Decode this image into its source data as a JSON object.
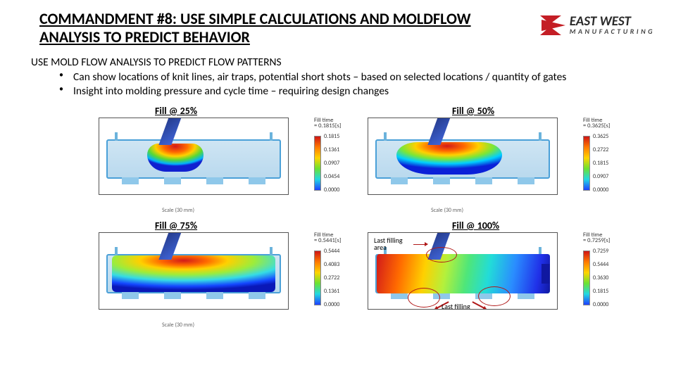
{
  "header": {
    "title": "COMMANDMENT #8: USE SIMPLE CALCULATIONS AND MOLDFLOW ANALYSIS TO PREDICT BEHAVIOR",
    "logo_main": "EAST WEST",
    "logo_sub": "MANUFACTURING"
  },
  "subtitle": "USE MOLD FLOW ANALYSIS TO PREDICT FLOW PATTERNS",
  "bullets": [
    "Can show locations of knit lines, air traps, potential short shots – based on selected locations / quantity of gates",
    "Insight into molding pressure and cycle time – requiring design changes"
  ],
  "panels": [
    {
      "label": "Fill @ 25%",
      "scale_caption": "Scale (30 mm)",
      "legend": {
        "title": "Fill time\n= 0.1815[s]",
        "unit": "[s]",
        "ticks": [
          "0.1815",
          "0.1361",
          "0.0907",
          "0.0454",
          "0.0000"
        ]
      }
    },
    {
      "label": "Fill @ 50%",
      "scale_caption": "Scale (30 mm)",
      "legend": {
        "title": "Fill time\n= 0.3625[s]",
        "unit": "[s]",
        "ticks": [
          "0.3625",
          "0.2722",
          "0.1815",
          "0.0907",
          "0.0000"
        ]
      }
    },
    {
      "label": "Fill @ 75%",
      "scale_caption": "Scale (30 mm)",
      "legend": {
        "title": "Fill time\n= 0.5441[s]",
        "unit": "[s]",
        "ticks": [
          "0.5444",
          "0.4083",
          "0.2722",
          "0.1361",
          "0.0000"
        ]
      }
    },
    {
      "label": "Fill @ 100%",
      "scale_caption": "",
      "legend": {
        "title": "Fill time\n= 0.7259[s]",
        "unit": "[s]",
        "ticks": [
          "0.7259",
          "0.5444",
          "0.3630",
          "0.1815",
          "0.0000"
        ]
      },
      "annot_top": "Last filling\narea",
      "annot_bottom": "Last filling\narea"
    }
  ]
}
